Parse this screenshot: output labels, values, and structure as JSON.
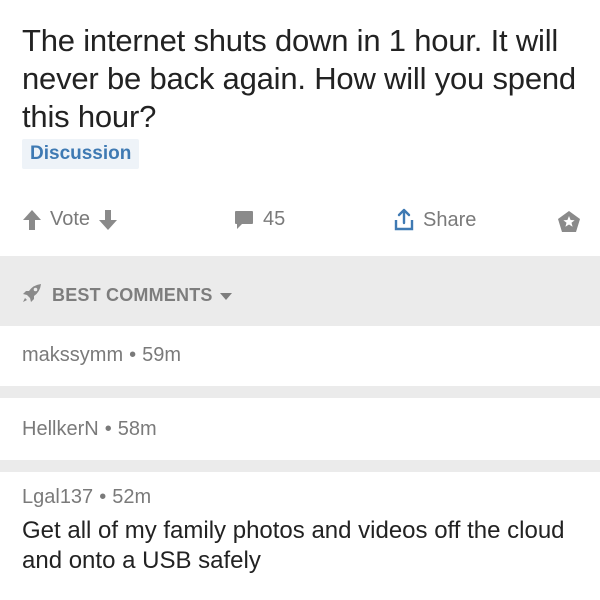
{
  "post": {
    "title": "The internet shuts down in 1 hour. It will never be back again. How will you spend this hour?",
    "flair": "Discussion"
  },
  "actions": {
    "vote_label": "Vote",
    "comment_count": "45",
    "share_label": "Share"
  },
  "sort": {
    "label": "BEST COMMENTS"
  },
  "comments": [
    {
      "author": "makssymm",
      "separator": "•",
      "age": "59m",
      "body": ""
    },
    {
      "author": "HellkerN",
      "separator": "•",
      "age": "58m",
      "body": ""
    },
    {
      "author": "Lgal137",
      "separator": "•",
      "age": "52m",
      "body": "Get all of my family photos and videos off the cloud and onto a USB safely"
    }
  ],
  "colors": {
    "flair_text": "#3f7ab3",
    "flair_bg": "#eef3f8",
    "muted": "#7a7a7a",
    "divider": "#ebebeb"
  },
  "icons": [
    "upvote-icon",
    "downvote-icon",
    "comment-icon",
    "share-icon",
    "save-icon",
    "rocket-icon",
    "caret-down-icon"
  ]
}
